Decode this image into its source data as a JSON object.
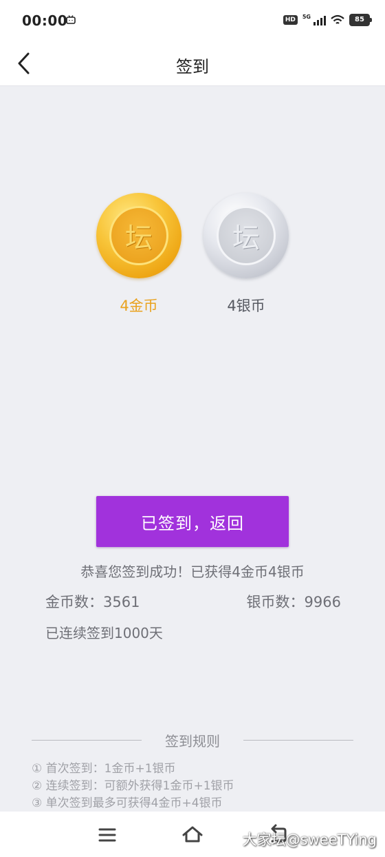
{
  "status_bar": {
    "time": "00:00",
    "hd": "HD",
    "network": "5G",
    "battery": "85"
  },
  "nav": {
    "title": "签到"
  },
  "coins": {
    "gold_glyph": "坛",
    "silver_glyph": "坛",
    "gold_label": "4金币",
    "silver_label": "4银币"
  },
  "actions": {
    "return_label": "已签到，返回"
  },
  "result": {
    "message": "恭喜您签到成功！已获得4金币4银币",
    "gold_count": "金币数：3561",
    "silver_count": "银币数：9966",
    "streak": "已连续签到1000天"
  },
  "rules": {
    "title": "签到规则",
    "items": [
      "① 首次签到：1金币+1银币",
      "② 连续签到：可额外获得1金币+1银币",
      "③ 单次签到最多可获得4金币+4银币"
    ]
  },
  "watermark": "大家坛@sweeTYing",
  "colors": {
    "accent": "#a132dc",
    "gold": "#e9a21e",
    "background": "#eeeff3"
  },
  "icons": {
    "back": "chevron-left-icon",
    "menu": "hamburger-icon",
    "home": "home-icon",
    "recent": "return-icon"
  }
}
